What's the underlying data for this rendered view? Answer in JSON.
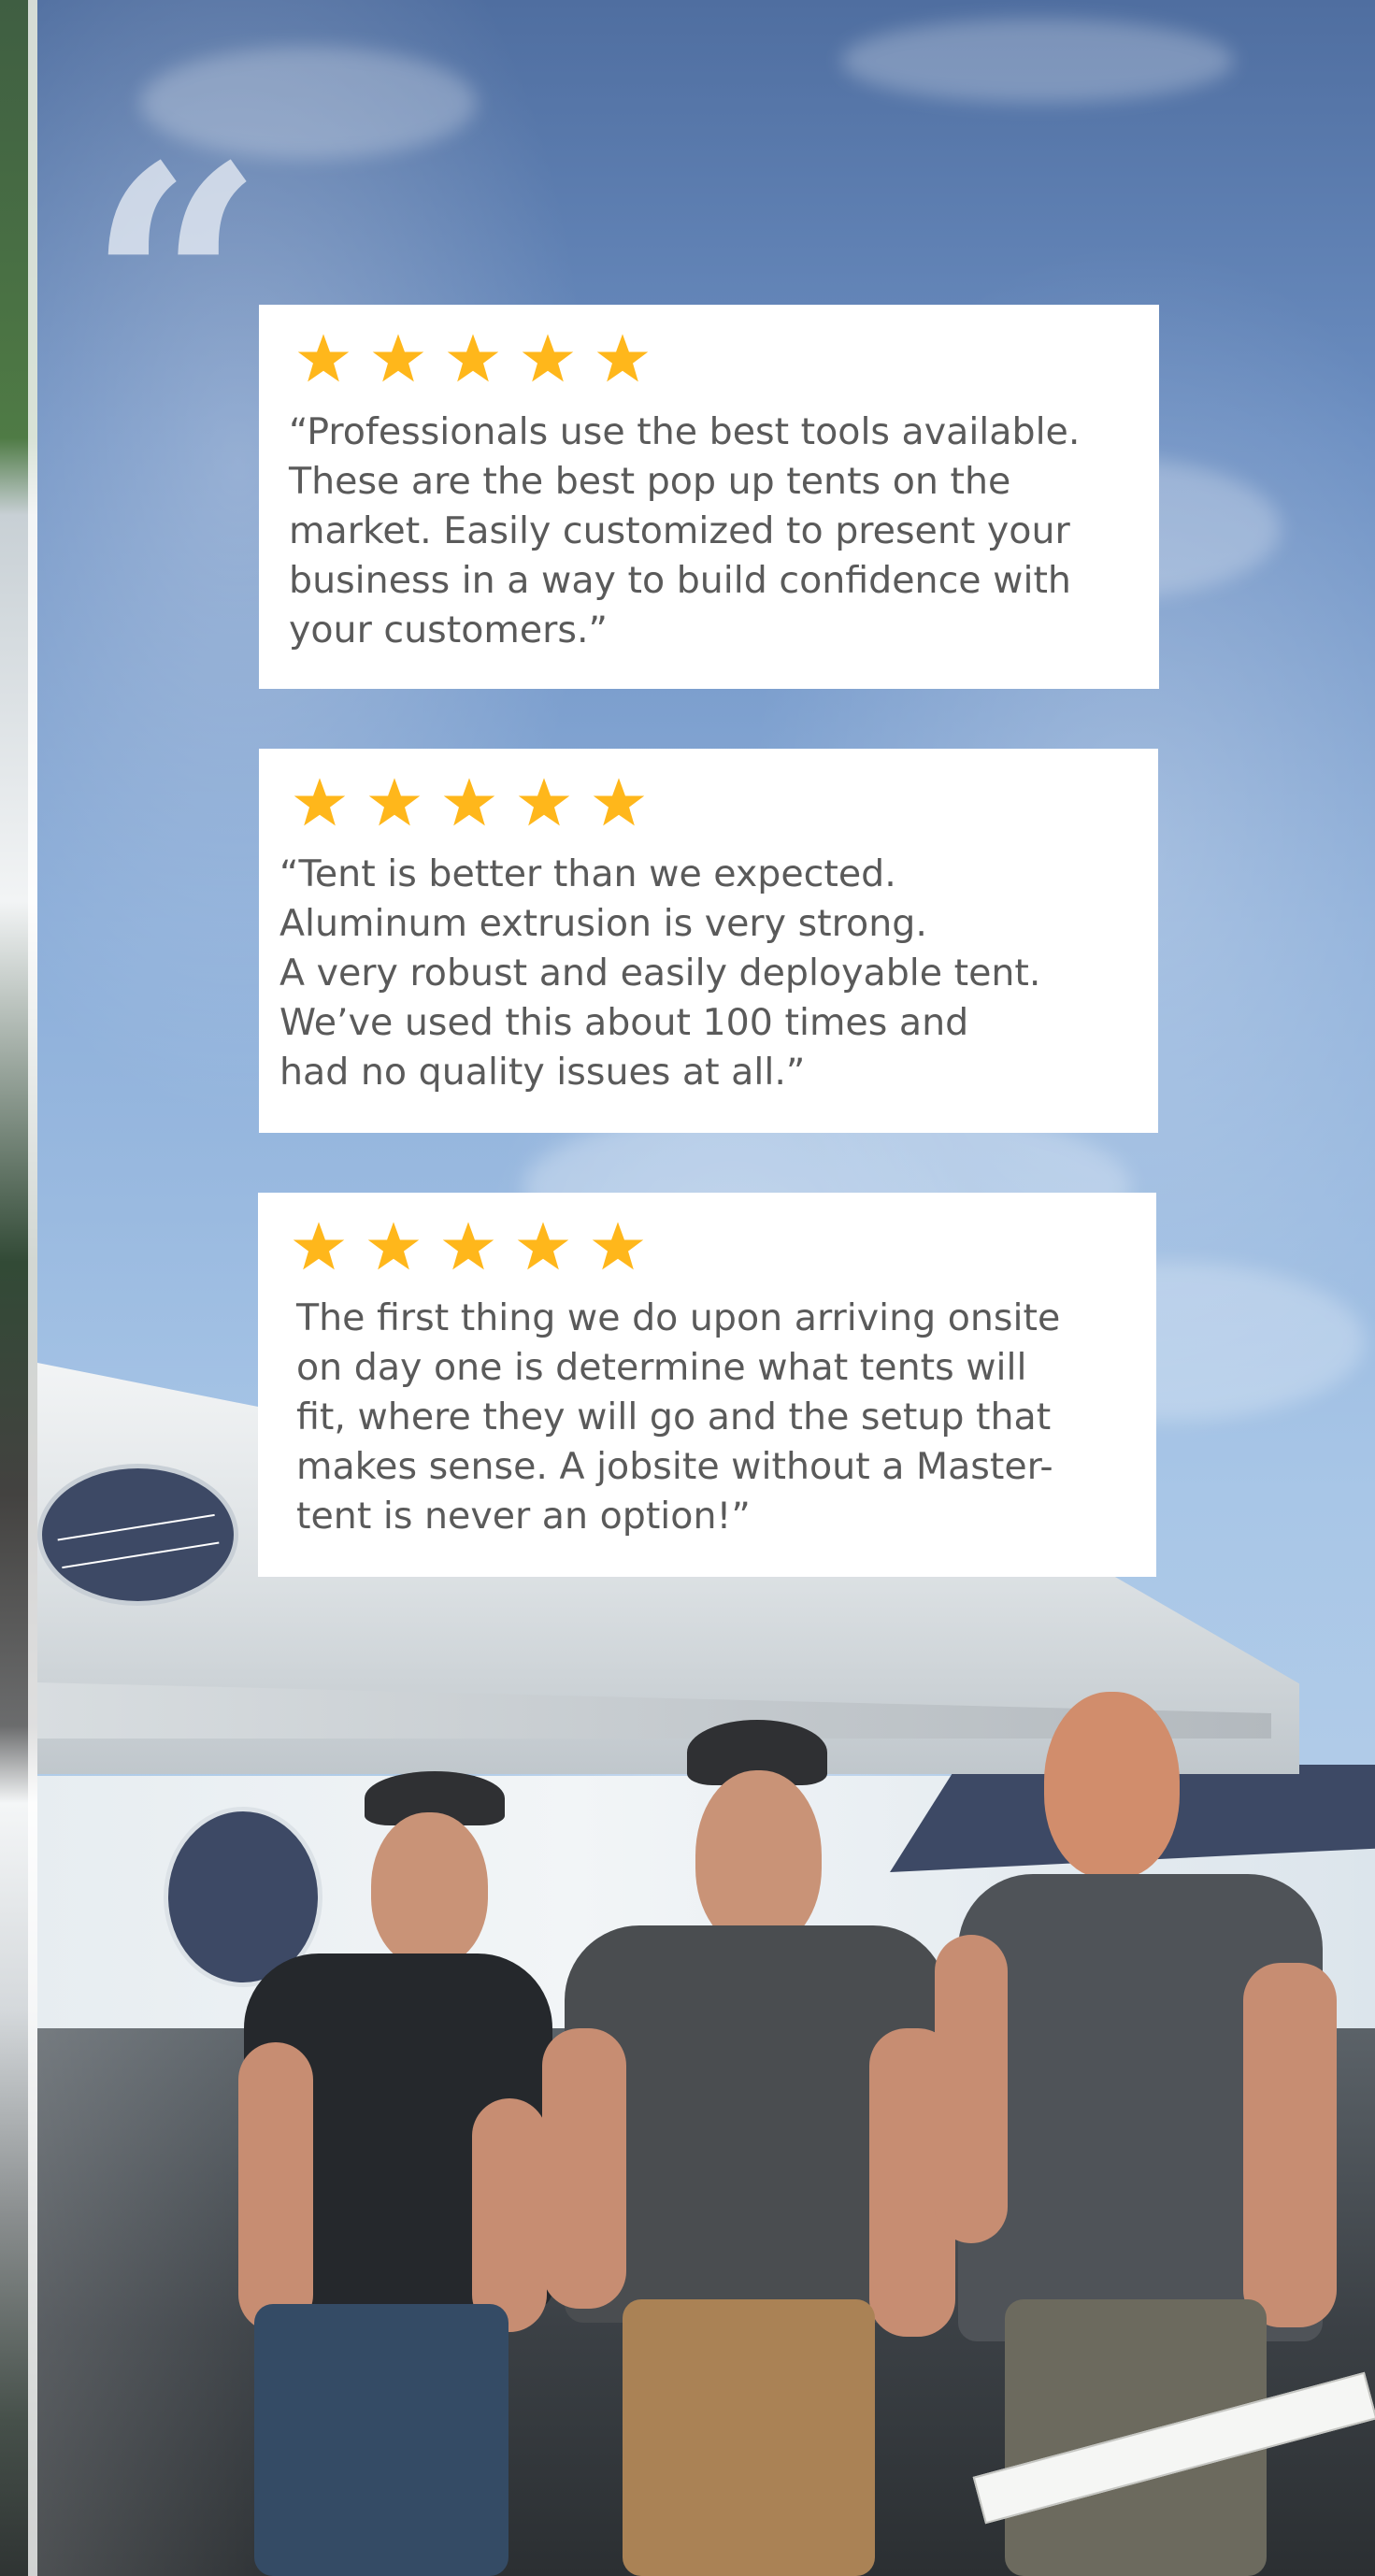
{
  "reviews": [
    {
      "rating": 5,
      "text": "“Professionals use the best tools available.\n These are the best pop up tents on the\n market. Easily customized to present your\n business in a way to build confidence with\n your customers.”"
    },
    {
      "rating": 5,
      "text": "“Tent is better than we expected.\n Aluminum extrusion is very strong.\n A very robust and easily deployable tent.\n We’ve used this about 100 times and\n had no quality issues at all.”"
    },
    {
      "rating": 5,
      "text": "The first thing we do upon arriving onsite\non day one is determine what tents will\nfit, where they will go and the setup that\nmakes sense. A jobsite without a Master-\ntent is never an option!”"
    }
  ],
  "colors": {
    "star": "#ffb71b",
    "card_background": "#ffffff",
    "review_text": "#5a5a5a",
    "quote_mark": "#e9edf3"
  },
  "icons": {
    "quote": "large-quotation-mark-icon",
    "rating": "star-icon"
  }
}
